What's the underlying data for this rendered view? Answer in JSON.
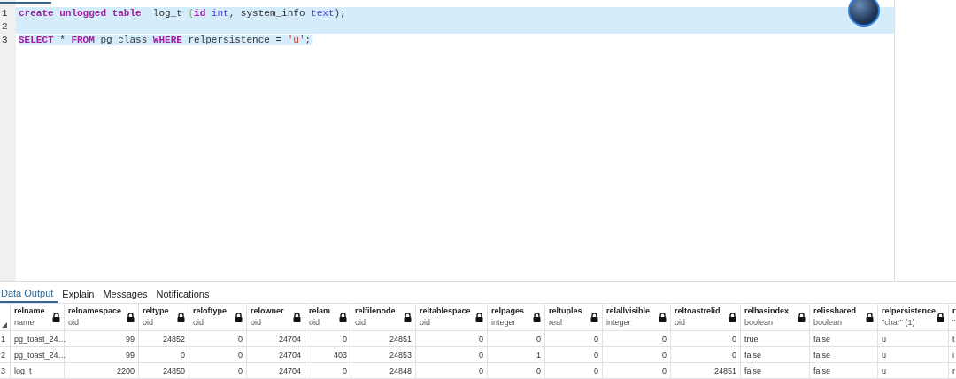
{
  "editor": {
    "lines": [
      {
        "number": "1",
        "selected": true,
        "tokens": [
          {
            "kind": "keyword",
            "text": "create"
          },
          {
            "kind": "keyword",
            "text": " unlogged"
          },
          {
            "kind": "keyword",
            "text": " table"
          },
          {
            "kind": "plain",
            "text": "  log_t"
          },
          {
            "kind": "punct",
            "text": " ("
          },
          {
            "kind": "keyword",
            "text": "id"
          },
          {
            "kind": "type",
            "text": " int"
          },
          {
            "kind": "plain",
            "text": ", system_info"
          },
          {
            "kind": "type",
            "text": " text"
          },
          {
            "kind": "plain",
            "text": ");"
          }
        ]
      },
      {
        "number": "2",
        "selected": true
      },
      {
        "number": "3",
        "selected": false,
        "partial_selection": true,
        "tokens": [
          {
            "kind": "keyword",
            "text": "SELECT"
          },
          {
            "kind": "plain",
            "text": " * "
          },
          {
            "kind": "keyword",
            "text": "FROM"
          },
          {
            "kind": "plain",
            "text": " pg_class "
          },
          {
            "kind": "keyword",
            "text": "WHERE"
          },
          {
            "kind": "plain",
            "text": " relpersistence = "
          },
          {
            "kind": "string",
            "text": "'u'"
          },
          {
            "kind": "plain",
            "text": ";"
          }
        ]
      }
    ]
  },
  "tabs": [
    {
      "label": "Data Output",
      "selected": true
    },
    {
      "label": "Explain",
      "selected": false
    },
    {
      "label": "Messages",
      "selected": false
    },
    {
      "label": "Notifications",
      "selected": false
    }
  ],
  "table": {
    "columns": [
      {
        "name": "relname",
        "type": "name",
        "kind": "text",
        "locked": true
      },
      {
        "name": "relnamespace",
        "type": "oid",
        "kind": "number",
        "locked": true
      },
      {
        "name": "reltype",
        "type": "oid",
        "kind": "number",
        "locked": true
      },
      {
        "name": "reloftype",
        "type": "oid",
        "kind": "number",
        "locked": true
      },
      {
        "name": "relowner",
        "type": "oid",
        "kind": "number",
        "locked": true
      },
      {
        "name": "relam",
        "type": "oid",
        "kind": "number",
        "locked": true
      },
      {
        "name": "relfilenode",
        "type": "oid",
        "kind": "number",
        "locked": true
      },
      {
        "name": "reltablespace",
        "type": "oid",
        "kind": "number",
        "locked": true
      },
      {
        "name": "relpages",
        "type": "integer",
        "kind": "number",
        "locked": true
      },
      {
        "name": "reltuples",
        "type": "real",
        "kind": "number",
        "locked": true
      },
      {
        "name": "relallvisible",
        "type": "integer",
        "kind": "number",
        "locked": true
      },
      {
        "name": "reltoastrelid",
        "type": "oid",
        "kind": "number",
        "locked": true
      },
      {
        "name": "relhasindex",
        "type": "boolean",
        "kind": "text",
        "locked": true
      },
      {
        "name": "relisshared",
        "type": "boolean",
        "kind": "text",
        "locked": true
      },
      {
        "name": "relpersistence",
        "type": "\"char\" (1)",
        "kind": "text",
        "locked": true
      },
      {
        "name": "r",
        "type": "\"",
        "kind": "text"
      }
    ],
    "rows": [
      {
        "number": "1",
        "cells": [
          "pg_toast_24…",
          "99",
          "24852",
          "0",
          "24704",
          "0",
          "24851",
          "0",
          "0",
          "0",
          "0",
          "0",
          "true",
          "false",
          "u",
          "t"
        ]
      },
      {
        "number": "2",
        "cells": [
          "pg_toast_24…",
          "99",
          "0",
          "0",
          "24704",
          "403",
          "24853",
          "0",
          "1",
          "0",
          "0",
          "0",
          "false",
          "false",
          "u",
          "i"
        ]
      },
      {
        "number": "3",
        "cells": [
          "log_t",
          "2200",
          "24850",
          "0",
          "24704",
          "0",
          "24848",
          "0",
          "0",
          "0",
          "0",
          "24851",
          "false",
          "false",
          "u",
          "r"
        ]
      }
    ]
  }
}
